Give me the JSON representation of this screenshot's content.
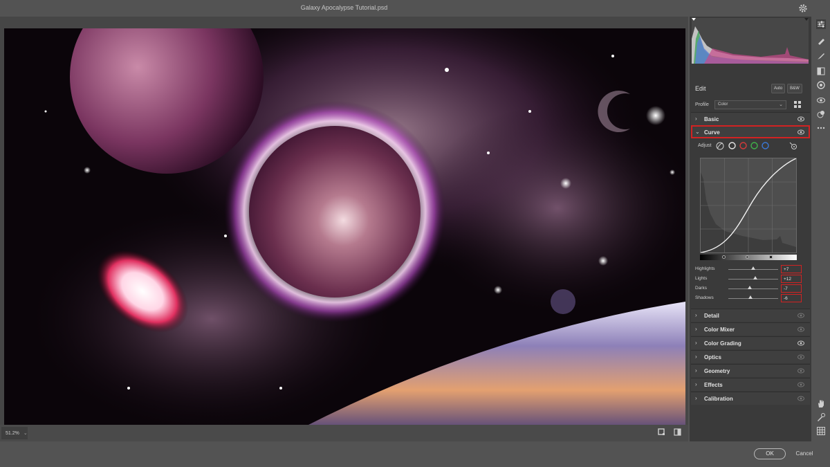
{
  "window": {
    "title": "Galaxy Apocalypse Tutorial.psd"
  },
  "zoom": {
    "value": "51.2%"
  },
  "panel": {
    "edit_label": "Edit",
    "auto_label": "Auto",
    "bw_label": "B&W",
    "profile_label": "Profile",
    "profile_value": "Color",
    "adjust_label": "Adjust",
    "sections": {
      "basic": "Basic",
      "curve": "Curve",
      "detail": "Detail",
      "color_mixer": "Color Mixer",
      "color_grading": "Color Grading",
      "optics": "Optics",
      "geometry": "Geometry",
      "effects": "Effects",
      "calibration": "Calibration"
    },
    "curve_sliders": [
      {
        "label": "Highlights",
        "value": "+7"
      },
      {
        "label": "Lights",
        "value": "+12"
      },
      {
        "label": "Darks",
        "value": "-7"
      },
      {
        "label": "Shadows",
        "value": "-6"
      }
    ]
  },
  "footer": {
    "ok_label": "OK",
    "cancel_label": "Cancel"
  },
  "colors": {
    "highlight": "#d32222",
    "panel": "#3a3a3a",
    "chrome": "#535353"
  },
  "icons": [
    "settings-gear-icon",
    "edit-sliders-icon",
    "healing-brush-icon",
    "brush-icon",
    "linear-gradient-icon",
    "radial-filter-icon",
    "red-eye-icon",
    "presets-icon",
    "more-icon",
    "hand-icon",
    "sampler-icon",
    "grid-icon",
    "eye-icon",
    "chevron-right-icon",
    "chevron-down-icon"
  ]
}
